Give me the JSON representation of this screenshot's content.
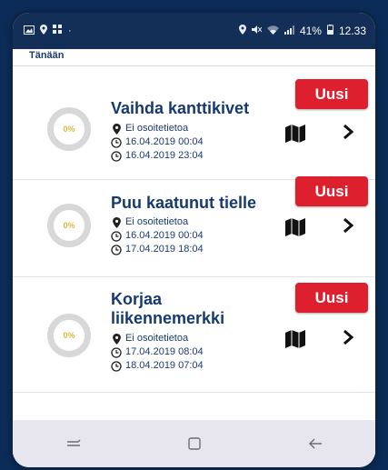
{
  "status_bar": {
    "left_icons": [
      "gallery-icon",
      "location-icon",
      "apps-icon",
      "dot-icon"
    ],
    "battery": "41%",
    "time": "12.33"
  },
  "section": {
    "label": "Tänään"
  },
  "tasks": [
    {
      "title": "Vaihda kanttikivet",
      "progress_label": "0%",
      "progress": 0,
      "address": "Ei osoitetietoa",
      "start": "16.04.2019 00:04",
      "end": "16.04.2019 23:04",
      "badge": "Uusi"
    },
    {
      "title": "Puu kaatunut tielle",
      "progress_label": "0%",
      "progress": 0,
      "address": "Ei osoitetietoa",
      "start": "16.04.2019 00:04",
      "end": "17.04.2019 18:04",
      "badge": "Uusi"
    },
    {
      "title": "Korjaa liikennemerkki",
      "progress_label": "0%",
      "progress": 0,
      "address": "Ei osoitetietoa",
      "start": "17.04.2019 08:04",
      "end": "18.04.2019 07:04",
      "badge": "Uusi"
    }
  ],
  "colors": {
    "accent": "#dd1f2e",
    "title": "#163a70",
    "progress": "#d5bb3c",
    "status_bar": "#132e57"
  }
}
